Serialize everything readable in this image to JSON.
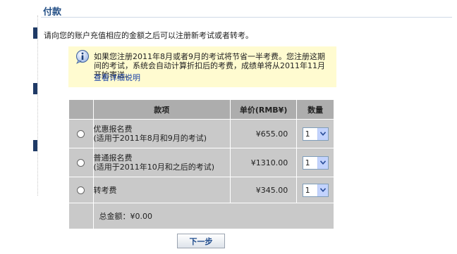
{
  "page": {
    "title": "付款",
    "instruction": "请向您的账户充值相应的金额之后可以注册新考试或者转考。"
  },
  "notice": {
    "icon": "info-icon",
    "text": "如果您注册2011年8月或者9月的考试将节省一半考费。您注册这期间的考试，系统会自动计算折扣后的考费，成绩单将从2011年11月开始寄送。",
    "link_text": "查看详细说明"
  },
  "table": {
    "headers": {
      "item": "款项",
      "price": "单价(RMB¥)",
      "quantity": "数量"
    },
    "rows": [
      {
        "name": "优惠报名费",
        "note": "(适用于2011年8月和9月的考试)",
        "price": "¥655.00",
        "quantity": "1",
        "selected": false
      },
      {
        "name": "普通报名费",
        "note": "(适用于2011年10月和之后的考试)",
        "price": "¥1310.00",
        "quantity": "1",
        "selected": false
      },
      {
        "name": "转考费",
        "note": "",
        "price": "¥345.00",
        "quantity": "1",
        "selected": false
      }
    ],
    "total": "总金额：¥0.00"
  },
  "actions": {
    "next_label": "下一步"
  },
  "colors": {
    "accent": "#234f86",
    "marker": "#1f3a66",
    "notice_bg": "#fffbd0",
    "header_bg": "#adadad",
    "row_bg": "#c9c9c9",
    "link": "#1d44a8"
  }
}
